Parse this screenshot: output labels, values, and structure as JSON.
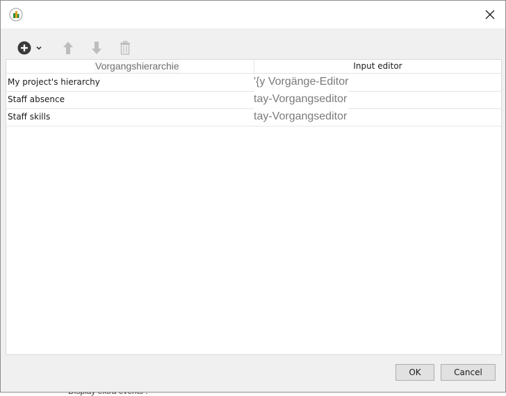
{
  "background": {
    "bleed_text": "Display extra events :"
  },
  "toolbar": {
    "icons": [
      "plus-circle-icon",
      "chevron-down-icon",
      "arrow-up-icon",
      "arrow-down-icon",
      "trash-icon"
    ]
  },
  "table": {
    "columns": [
      "Vorgangshierarchie",
      "Input editor"
    ],
    "rows": [
      {
        "name": "My project's hierarchy",
        "editor": "'{y Vorgänge-Editor"
      },
      {
        "name": "Staff absence",
        "editor": "tay-Vorgangseditor"
      },
      {
        "name": "Staff skills",
        "editor": "tay-Vorgangseditor"
      }
    ]
  },
  "buttons": {
    "ok": "OK",
    "cancel": "Cancel"
  },
  "colors": {
    "dialog_bg": "#f0f0f0",
    "grid_bg": "#ffffff",
    "button_bg": "#e1e1e1",
    "accent_line": "#2f5fb0"
  }
}
